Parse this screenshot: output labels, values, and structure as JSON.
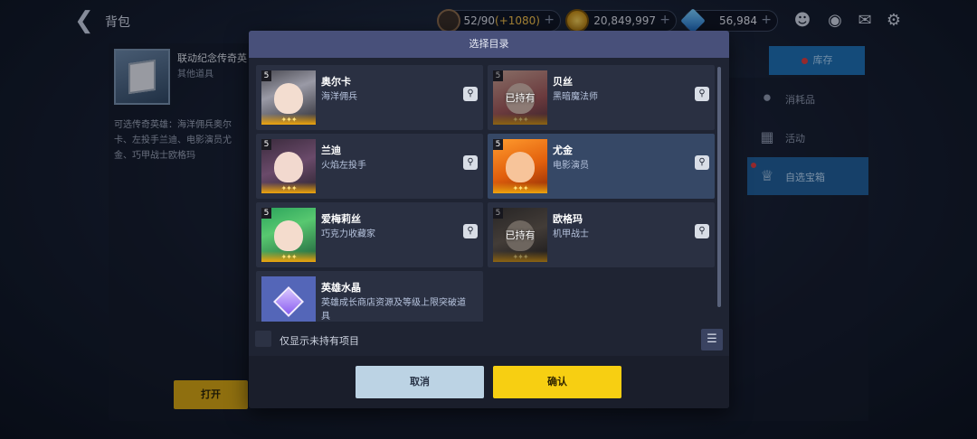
{
  "topbar": {
    "title": "背包",
    "stamina": {
      "value": "52/90",
      "bonus": "(+1080)"
    },
    "gold": "20,849,997",
    "gems": "56,984",
    "plus": "+"
  },
  "left_panel": {
    "item_name": "联动纪念传奇英",
    "item_type": "其他道具",
    "description": "可选传奇英雄：海洋佣兵奥尔卡、左投手兰迪、电影演员尤金、巧甲战士欧格玛",
    "open_label": "打开"
  },
  "right_panel": {
    "store_label": "库存",
    "categories": [
      {
        "label": "消耗品",
        "icon": "potion-icon"
      },
      {
        "label": "活动",
        "icon": "calendar-icon"
      },
      {
        "label": "自选宝箱",
        "icon": "crown-icon"
      }
    ]
  },
  "modal": {
    "title": "选择目录",
    "items": [
      {
        "name": "奥尔卡",
        "subtitle": "海洋佣兵",
        "grade": "5",
        "stars": "✦✦✦",
        "owned": false
      },
      {
        "name": "贝丝",
        "subtitle": "黑暗魔法师",
        "grade": "5",
        "stars": "✦✦✦",
        "owned": true,
        "owned_label": "已持有"
      },
      {
        "name": "兰迪",
        "subtitle": "火焰左投手",
        "grade": "5",
        "stars": "✦✦✦",
        "owned": false
      },
      {
        "name": "尤金",
        "subtitle": "电影演员",
        "grade": "5",
        "stars": "✦✦✦",
        "owned": false,
        "selected": true
      },
      {
        "name": "爱梅莉丝",
        "subtitle": "巧克力收藏家",
        "grade": "5",
        "stars": "✦✦✦",
        "owned": false
      },
      {
        "name": "欧格玛",
        "subtitle": "机甲战士",
        "grade": "5",
        "stars": "✦✦✦",
        "owned": true,
        "owned_label": "已持有"
      },
      {
        "name": "英雄水晶",
        "subtitle": "英雄成长商店资源及等级上限突破道具"
      }
    ],
    "filter_label": "仅显示未持有项目",
    "cancel_label": "取消",
    "confirm_label": "确认"
  },
  "colors": {
    "header": "#48507a",
    "confirm": "#f7cf12",
    "cancel": "#bcd3e4",
    "selected_card": "#364866",
    "store": "#1d6fb2"
  }
}
